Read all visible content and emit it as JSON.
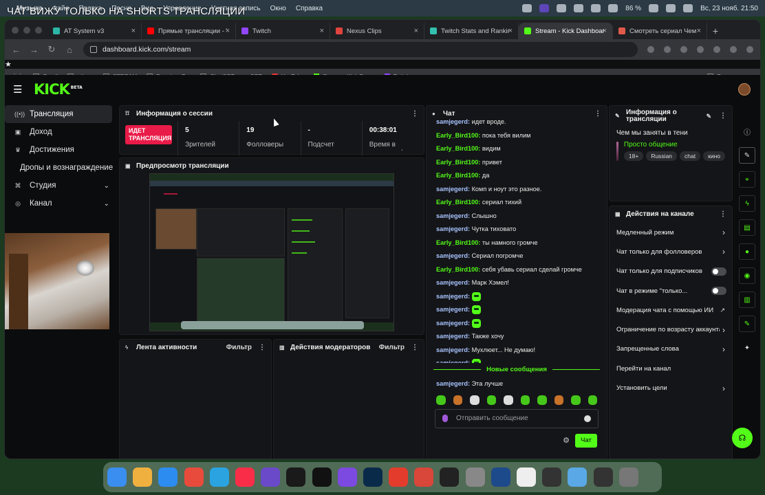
{
  "overlay_title": "ЧАТ ВИЖУ ТОЛЬКО НА SHORTS ТРАНСЛЯЦИИ",
  "menubar": {
    "app": "Музыка",
    "items": [
      "Файл",
      "Правка",
      "Песня",
      "Вид",
      "Управление",
      "Учетная запись",
      "Окно",
      "Справка"
    ],
    "battery": "86 %",
    "datetime": "Вс, 23 нояб.  21:50"
  },
  "tabs": [
    {
      "label": "AT System v3",
      "color": "#2bb6a8"
    },
    {
      "label": "Прямые трансляции - Yo",
      "color": "#ff0000"
    },
    {
      "label": "Twitch",
      "color": "#9146ff"
    },
    {
      "label": "Nexus Clips",
      "color": "#e0443e"
    },
    {
      "label": "Twitch Stats and Ranking",
      "color": "#33c0b0"
    },
    {
      "label": "Stream - Kick Dashboard",
      "color": "#53fc18"
    },
    {
      "label": "Смотреть сериал Чем м",
      "color": "#e05a4a"
    }
  ],
  "url": "dashboard.kick.com/stream",
  "bookmarks": [
    "Gmail",
    "others",
    "STREAM",
    "Premiere Pro",
    "ChatGPT - чат GPT",
    "YouTube",
    "Stream - Kick Das...",
    "Twitch"
  ],
  "all_bookmarks": "Все закладки",
  "logo": "KICK",
  "logo_badge": "BETA",
  "sidebar": {
    "items": [
      {
        "label": "Трансляция",
        "icon": "broadcast-icon"
      },
      {
        "label": "Доход",
        "icon": "dollar-icon"
      },
      {
        "label": "Достижения",
        "icon": "trophy-icon"
      },
      {
        "label": "Дропы и вознаграждение",
        "icon": ""
      },
      {
        "label": "Студия",
        "icon": "studio-icon"
      },
      {
        "label": "Канал",
        "icon": "channel-icon"
      }
    ]
  },
  "session": {
    "title": "Информация о сессии",
    "live_badge": "ИДЕТ ТРАНСЛЯЦИЯ",
    "stats": [
      {
        "value": "5",
        "label": "Зрителей"
      },
      {
        "value": "19",
        "label": "Фолловеры"
      },
      {
        "value": "-",
        "label": "Подсчет подписок"
      },
      {
        "value": "00:38:01",
        "label": "Время в прямом эфире"
      }
    ]
  },
  "preview_title": "Предпросмотр трансляции",
  "activity": {
    "title": "Лента активности",
    "filter": "Фильтр"
  },
  "modactions": {
    "title": "Действия модераторов",
    "filter": "Фильтр"
  },
  "chat": {
    "title": "Чат",
    "messages": [
      {
        "user": "samjegerd",
        "type": "u1",
        "text": "идет вроде."
      },
      {
        "user": "Early_Bird100",
        "type": "u2",
        "text": "пока тебя вилим"
      },
      {
        "user": "Early_Bird100",
        "type": "u2",
        "text": "видим"
      },
      {
        "user": "Early_Bird100",
        "type": "u2",
        "text": "привет"
      },
      {
        "user": "Early_Bird100",
        "type": "u2",
        "text": "да"
      },
      {
        "user": "samjegerd",
        "type": "u1",
        "text": "Комп и ноут это разное."
      },
      {
        "user": "Early_Bird100",
        "type": "u2",
        "text": "сериал тихий"
      },
      {
        "user": "samjegerd",
        "type": "u1",
        "text": "Слышно"
      },
      {
        "user": "samjegerd",
        "type": "u1",
        "text": "Чутка тиховато"
      },
      {
        "user": "Early_Bird100",
        "type": "u2",
        "text": "ты намного громче"
      },
      {
        "user": "samjegerd",
        "type": "u1",
        "text": "Сериал погромче"
      },
      {
        "user": "Early_Bird100",
        "type": "u2",
        "text": "себя убавь сериал сделай громче"
      },
      {
        "user": "samjegerd",
        "type": "u1",
        "text": "Марк Хэмел!"
      },
      {
        "user": "samjegerd",
        "type": "u1",
        "text": ""
      },
      {
        "user": "samjegerd",
        "type": "u1",
        "text": ""
      },
      {
        "user": "samjegerd",
        "type": "u1",
        "text": ""
      },
      {
        "user": "samjegerd",
        "type": "u1",
        "text": "Также хочу"
      },
      {
        "user": "samjegerd",
        "type": "u1",
        "text": "Мухлюет... Не думаю!"
      },
      {
        "user": "samjegerd",
        "type": "u1",
        "text": ""
      }
    ],
    "new_messages_label": "Новые сообщения",
    "after": [
      {
        "user": "samjegerd",
        "type": "u1",
        "text": "Эта лучше"
      }
    ],
    "placeholder": "Отправить сообщение",
    "send_label": "Чат"
  },
  "stream_info": {
    "title": "Информация о трансляции",
    "stream_title": "Чем мы заняты в тени",
    "category": "Просто общение",
    "tags": [
      "18+",
      "Russian",
      "chat",
      "кино"
    ]
  },
  "channel_actions": {
    "title": "Действия на канале",
    "items": [
      {
        "label": "Медленный режим",
        "control": "arrow"
      },
      {
        "label": "Чат только для фолловеров",
        "control": "arrow"
      },
      {
        "label": "Чат только для подписчиков",
        "control": "toggle"
      },
      {
        "label": "Чат в режиме \"только...",
        "control": "toggle"
      },
      {
        "label": "Модерация чата с помощью ИИ",
        "control": "external"
      },
      {
        "label": "Ограничение по возрасту аккаунта",
        "control": "arrow"
      },
      {
        "label": "Запрещенные слова",
        "control": "arrow"
      },
      {
        "label": "Перейти на канал",
        "control": "none"
      },
      {
        "label": "Установить цели",
        "control": "arrow"
      }
    ]
  },
  "colors": {
    "accent": "#53fc18",
    "live": "#e91b48"
  }
}
